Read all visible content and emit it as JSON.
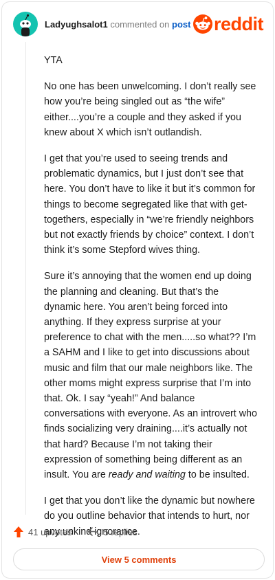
{
  "comment": {
    "username": "Ladyughsalot1",
    "action_text": "commented on",
    "target_text": "post",
    "avatar_icon": "snoo-avatar-icon",
    "avatar_color": "#14c3b0",
    "paragraphs": [
      {
        "text": "YTA"
      },
      {
        "text": "No one has been unwelcoming. I don’t really see how you’re being singled out as “the wife” either....you’re a couple and they asked if you knew about X which isn’t outlandish."
      },
      {
        "text": "I get that you’re used to seeing trends and problematic dynamics, but I just don’t see that here. You don’t have to like it but it’s common for things to become segregated like that with get-togethers, especially in “we’re friendly neighbors but not exactly friends by choice” context. I don’t think it’s some Stepford wives thing."
      },
      {
        "text": "Sure it’s annoying that the women end up doing the planning and cleaning. But that’s the dynamic here. You aren’t being forced into anything. If they express surprise at your preference to chat with the men.....so what?? I’m a SAHM and I like to get into discussions about music and film that our male neighbors like. The other moms might express surprise that I’m into that. Ok. I say “yeah!” And balance conversations with everyone. As an introvert who finds socializing very draining....it’s actually not that hard? Because I’m not taking their expression of something being different as an insult. You are ",
        "italic": "ready and waiting",
        "tail": " to be insulted."
      },
      {
        "text": "I get that you don’t like the dynamic but nowhere do you outline behavior that intends to hurt, nor any unkind ignorance."
      }
    ]
  },
  "brand": {
    "logo_text": "reddit",
    "logo_icon": "reddit-snoo-icon",
    "color": "#ff4500"
  },
  "actions": {
    "upvotes_label": "41 upvotes",
    "upvote_icon": "upvote-arrow-icon",
    "upvote_color": "#ff4500",
    "replies_label": "5 replies",
    "reply_icon": "reply-arrow-icon"
  },
  "footer": {
    "view_comments_label": "View 5 comments",
    "accent": "#e0410b"
  }
}
